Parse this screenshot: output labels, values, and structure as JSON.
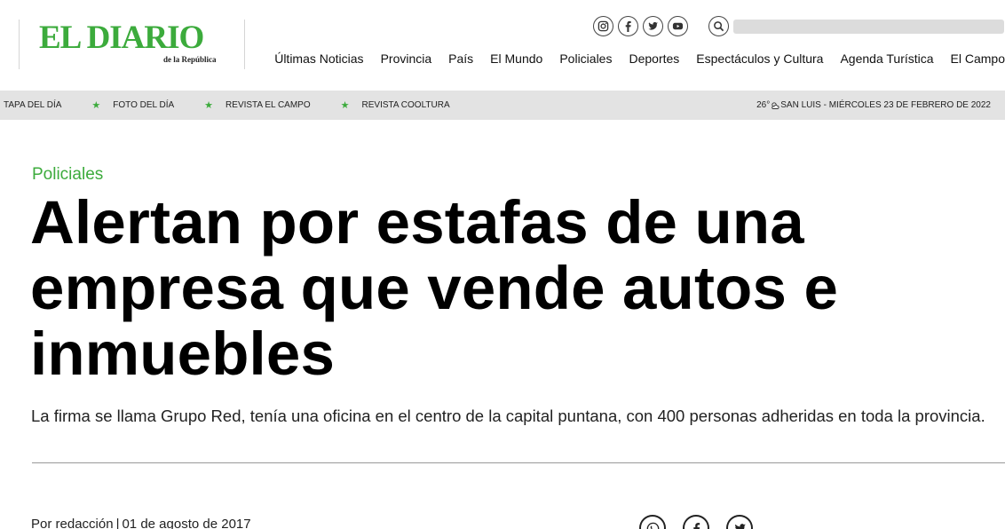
{
  "brand": {
    "title": "EL DIARIO",
    "subtitle": "de la República",
    "color": "#3cab3c"
  },
  "social": [
    {
      "icon": "instagram-icon"
    },
    {
      "icon": "facebook-icon"
    },
    {
      "icon": "twitter-icon"
    },
    {
      "icon": "youtube-icon"
    }
  ],
  "search": {
    "placeholder": "",
    "icon": "search-icon"
  },
  "nav": [
    "Últimas Noticias",
    "Provincia",
    "País",
    "El Mundo",
    "Policiales",
    "Deportes",
    "Espectáculos y Cultura",
    "Agenda Turística",
    "El Campo"
  ],
  "subbar": {
    "links": [
      "TAPA DEL DÍA",
      "FOTO DEL DÍA",
      "REVISTA EL CAMPO",
      "REVISTA COOLTURA"
    ],
    "temperature": "26°",
    "weather_icon": "partly-cloudy-icon",
    "location_date": "SAN LUIS - MIÉRCOLES 23 DE FEBRERO DE 2022"
  },
  "article": {
    "category": "Policiales",
    "headline": "Alertan por estafas de una empresa que vende autos e inmuebles",
    "lead": "La firma se llama Grupo Red, tenía una oficina en el centro de la capital puntana, con 400 personas adheridas en toda la provincia.",
    "author": "Por redacción",
    "separator": "|",
    "date": "01 de agosto de 2017"
  },
  "share": [
    {
      "icon": "whatsapp-icon"
    },
    {
      "icon": "facebook-icon"
    },
    {
      "icon": "twitter-icon"
    }
  ]
}
